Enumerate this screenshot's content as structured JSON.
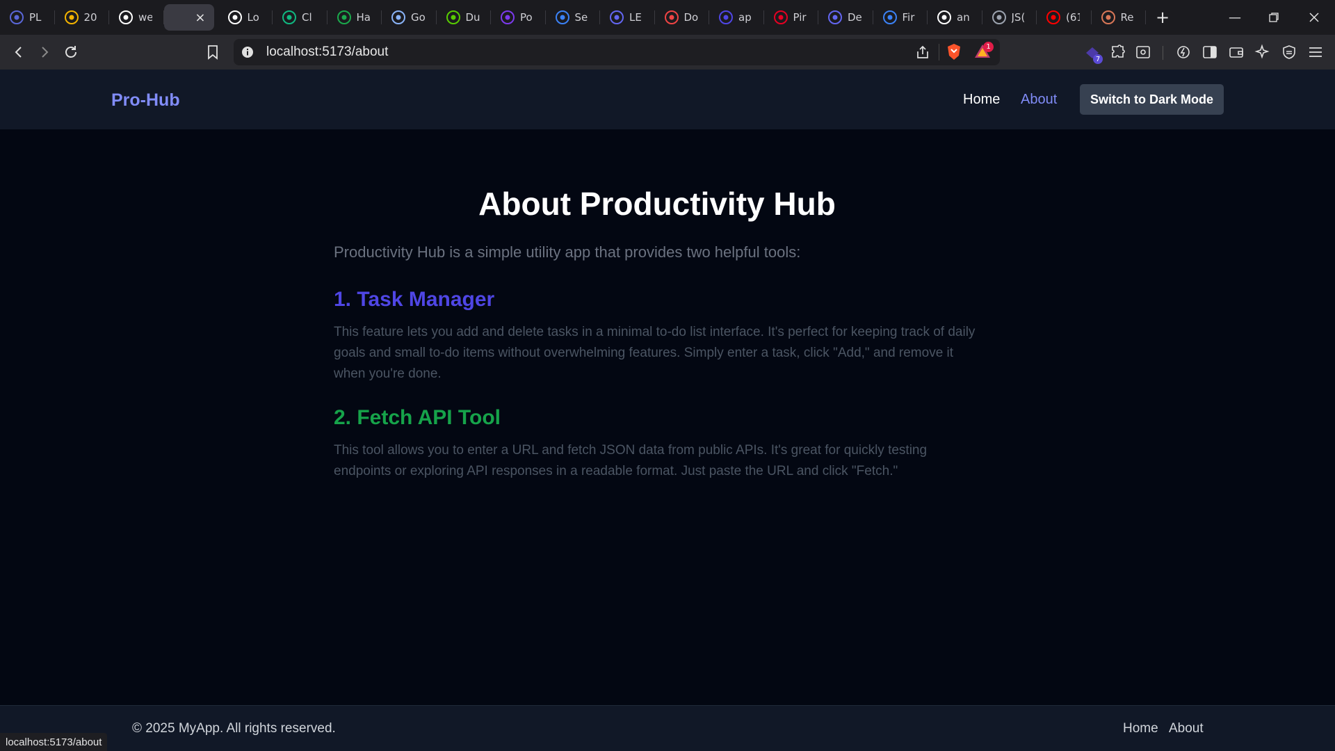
{
  "browser": {
    "tabs": [
      {
        "title": "PL",
        "icon": "prisma-icon",
        "color": "#5a67d8"
      },
      {
        "title": "20",
        "icon": "drive-icon",
        "color": "#f4b400"
      },
      {
        "title": "we",
        "icon": "github-icon",
        "color": "#ffffff"
      },
      {
        "title": "",
        "icon": "",
        "color": "",
        "active": true
      },
      {
        "title": "Lo",
        "icon": "openai-icon",
        "color": "#ffffff"
      },
      {
        "title": "Cl",
        "icon": "mongodb-icon",
        "color": "#10b981"
      },
      {
        "title": "Ha",
        "icon": "hackerrank-icon",
        "color": "#1ba94c"
      },
      {
        "title": "Go",
        "icon": "google-icon",
        "color": "#8ab4f8"
      },
      {
        "title": "Du",
        "icon": "duolingo-icon",
        "color": "#58cc02"
      },
      {
        "title": "Po",
        "icon": "b-icon",
        "color": "#7c3aed"
      },
      {
        "title": "Se",
        "icon": "c-icon",
        "color": "#3b82f6"
      },
      {
        "title": "LE",
        "icon": "le-icon",
        "color": "#6366f1"
      },
      {
        "title": "Do",
        "icon": "heart-icon",
        "color": "#ef4444"
      },
      {
        "title": "ap",
        "icon": "p-icon",
        "color": "#4f46e5"
      },
      {
        "title": "Pir",
        "icon": "pinterest-icon",
        "color": "#e60023"
      },
      {
        "title": "De",
        "icon": "dev-icon",
        "color": "#6366f1"
      },
      {
        "title": "Fir",
        "icon": "bookmark-icon",
        "color": "#3b82f6"
      },
      {
        "title": "an",
        "icon": "github-icon",
        "color": "#ffffff"
      },
      {
        "title": "JS(",
        "icon": "json-icon",
        "color": "#9ca3af"
      },
      {
        "title": "(61",
        "icon": "youtube-icon",
        "color": "#ff0000"
      },
      {
        "title": "Re",
        "icon": "claude-icon",
        "color": "#d97757"
      }
    ],
    "active_tab_close": "×",
    "new_tab": "+",
    "url": "localhost:5173/about",
    "status_url": "localhost:5173/about",
    "brave_badge": "1",
    "extensions_badge": "7"
  },
  "nav": {
    "brand": "Pro-Hub",
    "home": "Home",
    "about": "About",
    "theme_button": "Switch to Dark Mode"
  },
  "main": {
    "title": "About Productivity Hub",
    "intro": "Productivity Hub is a simple utility app that provides two helpful tools:",
    "section1_title": "1. Task Manager",
    "section1_text": "This feature lets you add and delete tasks in a minimal to-do list interface. It's perfect for keeping track of daily goals and small to-do items without overwhelming features. Simply enter a task, click \"Add,\" and remove it when you're done.",
    "section2_title": "2. Fetch API Tool",
    "section2_text": "This tool allows you to enter a URL and fetch JSON data from public APIs. It's great for quickly testing endpoints or exploring API responses in a readable format. Just paste the URL and click \"Fetch.\""
  },
  "footer": {
    "copyright": "© 2025 MyApp. All rights reserved.",
    "home": "Home",
    "about": "About"
  }
}
